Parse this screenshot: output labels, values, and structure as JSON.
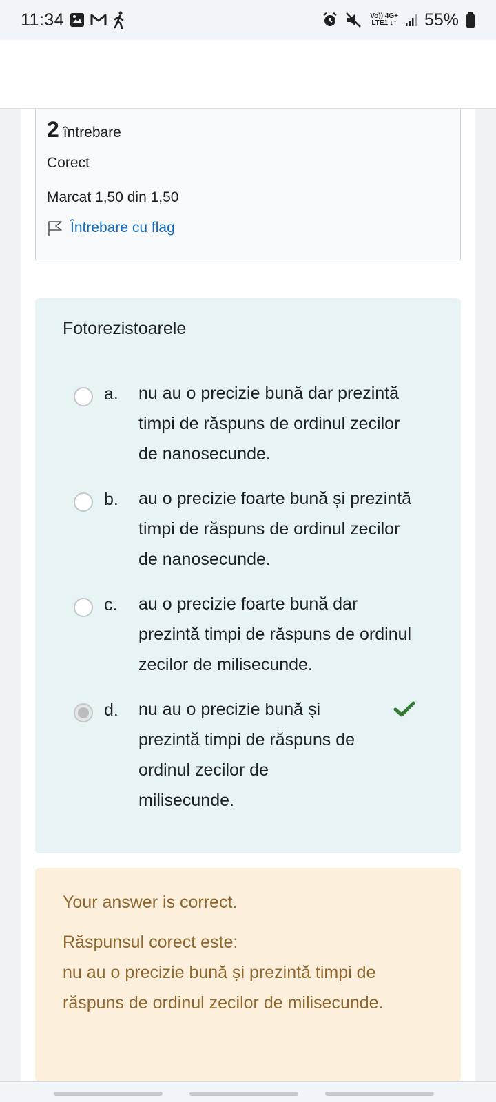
{
  "status_bar": {
    "time": "11:34",
    "left_icons": [
      "gallery-icon",
      "gmail-icon",
      "walking-icon"
    ],
    "network_top": "Vo)) 4G+",
    "network_bottom": "LTE1 ↓↑",
    "battery_percent": "55%"
  },
  "info": {
    "question_number": "2",
    "question_word": "întrebare",
    "status": "Corect",
    "mark": "Marcat 1,50 din 1,50",
    "flag_label": "Întrebare cu flag"
  },
  "question": {
    "text": "Fotorezistoarele",
    "answers": [
      {
        "letter": "a.",
        "text": "nu au o precizie bună dar prezintă timpi de răspuns de ordinul zecilor de nanosecunde.",
        "selected": false
      },
      {
        "letter": "b.",
        "text": "au o precizie foarte bună și prezintă timpi de răspuns de ordinul zecilor de nanosecunde.",
        "selected": false
      },
      {
        "letter": "c.",
        "text": "au o precizie foarte bună dar prezintă timpi de răspuns de ordinul zecilor de milisecunde.",
        "selected": false
      },
      {
        "letter": "d.",
        "text": "nu au o precizie bună și prezintă timpi de răspuns de ordinul zecilor de milisecunde.",
        "selected": true,
        "correct": true
      }
    ]
  },
  "feedback": {
    "result": "Your answer is correct.",
    "correct_label": "Răspunsul corect este:",
    "correct_answer": "nu au o precizie bună și prezintă timpi de răspuns de ordinul zecilor de milisecunde."
  },
  "colors": {
    "link": "#0f6cbf",
    "question_bg": "#e7f3f5",
    "feedback_bg": "#fcefdc",
    "feedback_text": "#8e662e",
    "check_green": "#357a32"
  }
}
